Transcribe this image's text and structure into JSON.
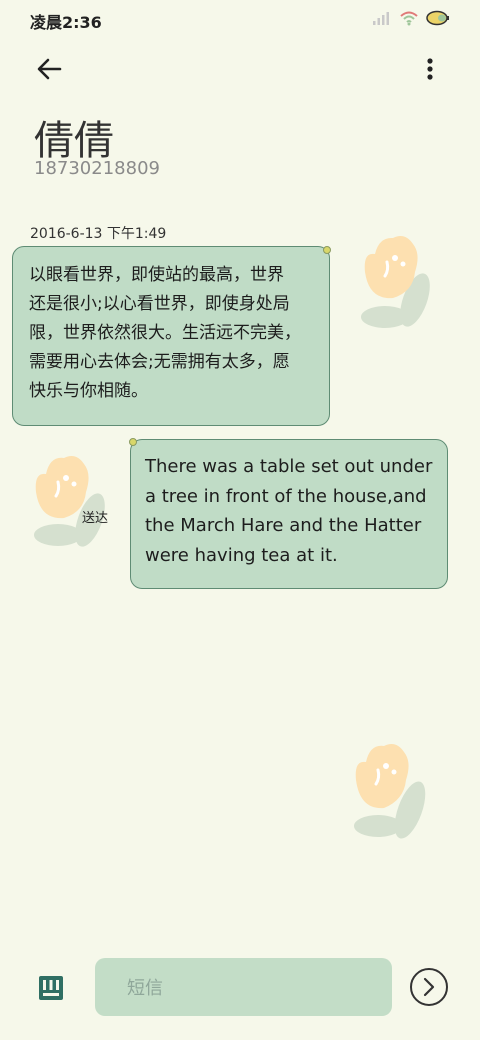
{
  "status_bar": {
    "time": "凌晨2:36",
    "icons": [
      "signal-icon",
      "wifi-icon",
      "battery-icon"
    ]
  },
  "header": {
    "back_icon": "back-arrow-icon",
    "more_icon": "more-vertical-icon"
  },
  "contact": {
    "name": "倩倩",
    "number": "18730218809"
  },
  "conversation": {
    "date": "2016-6-13 下午1:49",
    "messages": [
      {
        "direction": "incoming",
        "lines": [
          "以眼看世界，即使站的最高，世界",
          "还是很小;以心看世界，即使身处局",
          "限，世界依然很大。生活远不完美，",
          "需要用心去体会;无需拥有太多，愿",
          "快乐与你相随。"
        ]
      },
      {
        "direction": "outgoing",
        "status": "送达",
        "lines": [
          "There was a table set out under",
          "a tree in front of the house,and",
          "the March Hare and the Hatter",
          "were having tea at it."
        ]
      }
    ]
  },
  "composer": {
    "placeholder": "短信",
    "icon": "sim-card-icon",
    "send_icon": "send-icon"
  },
  "colors": {
    "background": "#f6f8ea",
    "bubble": "#c0dcc6",
    "bubble_border": "#5f8c74",
    "accent": "#2f6f63"
  }
}
